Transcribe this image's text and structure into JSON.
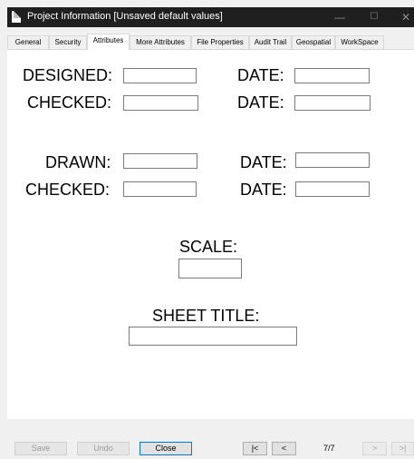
{
  "window": {
    "title": "Project Information [Unsaved default values]",
    "minimize_glyph": "—",
    "maximize_glyph": "☐",
    "close_glyph": "✕"
  },
  "tabs": [
    {
      "label": "General"
    },
    {
      "label": "Security"
    },
    {
      "label": "Attributes"
    },
    {
      "label": "More Attributes"
    },
    {
      "label": "File Properties"
    },
    {
      "label": "Audit Trail"
    },
    {
      "label": "Geospatial"
    },
    {
      "label": "WorkSpace"
    }
  ],
  "form": {
    "designed_label": "DESIGNED:",
    "designed_value": "",
    "designed_date_label": "DATE:",
    "designed_date_value": "",
    "checked1_label": "CHECKED:",
    "checked1_value": "",
    "checked1_date_label": "DATE:",
    "checked1_date_value": "",
    "drawn_label": "DRAWN:",
    "drawn_value": "",
    "drawn_date_label": "DATE:",
    "drawn_date_value": "",
    "checked2_label": "CHECKED:",
    "checked2_value": "",
    "checked2_date_label": "DATE:",
    "checked2_date_value": "",
    "scale_label": "SCALE:",
    "scale_value": "",
    "sheet_title_label": "SHEET TITLE:",
    "sheet_title_value": ""
  },
  "footer": {
    "save_label": "Save",
    "undo_label": "Undo",
    "close_label": "Close",
    "first_label": "|<",
    "prev_label": "<",
    "page_indicator": "7/7",
    "next_label": ">",
    "last_label": ">|"
  }
}
